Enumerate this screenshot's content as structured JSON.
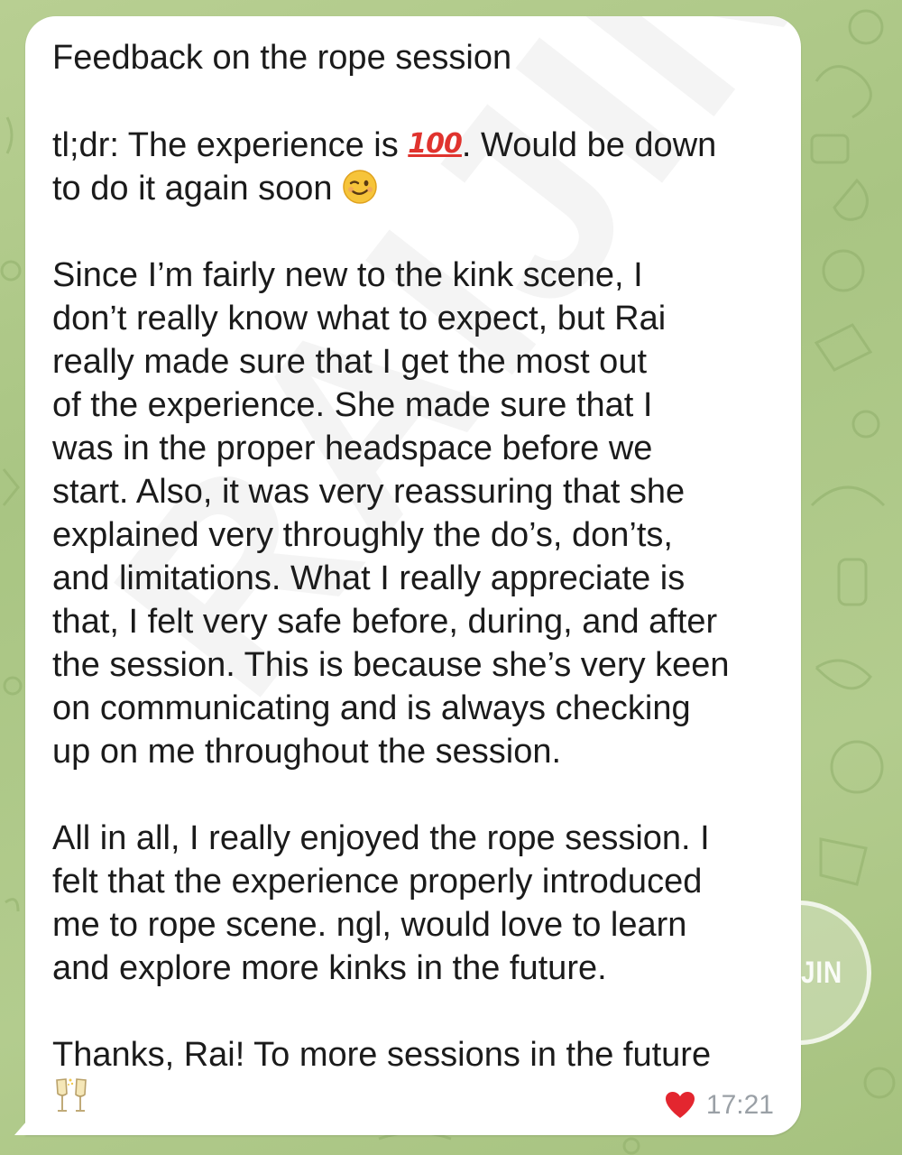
{
  "message": {
    "title": "Feedback on the rope session",
    "tldr_before": "tl;dr: The experience is ",
    "tldr_emoji": "100",
    "tldr_after": ". Would be down\nto do it again soon ",
    "paragraph_2": "Since I’m fairly new to the kink scene, I\ndon’t really know what to expect, but Rai\nreally made sure that I get the most out\nof the experience. She made sure that I\nwas in the proper headspace before we\nstart. Also, it was very reassuring that she\nexplained very throughly the do’s, don’ts,\nand limitations. What I really appreciate is\nthat, I felt very safe before, during, and after\nthe session. This is because she’s very keen\non communicating and is always checking\nup on me throughout the session.",
    "paragraph_3": "All in all, I really enjoyed the rope session. I\nfelt that the experience properly introduced\nme to rope scene. ngl, would love to learn\nand explore more kinks in the future.",
    "closing": "Thanks, Rai! To more sessions in the future\n",
    "reaction_icon": "heart-icon",
    "time": "17:21"
  },
  "watermark": {
    "diagonal_text": "RAIJIN",
    "stamp_text": "RAIJIN"
  },
  "colors": {
    "bubble": "#ffffff",
    "text": "#1b1b1b",
    "time": "#9aa0a6",
    "heart": "#e3262f",
    "wallpaper": "#b3cc8e"
  }
}
